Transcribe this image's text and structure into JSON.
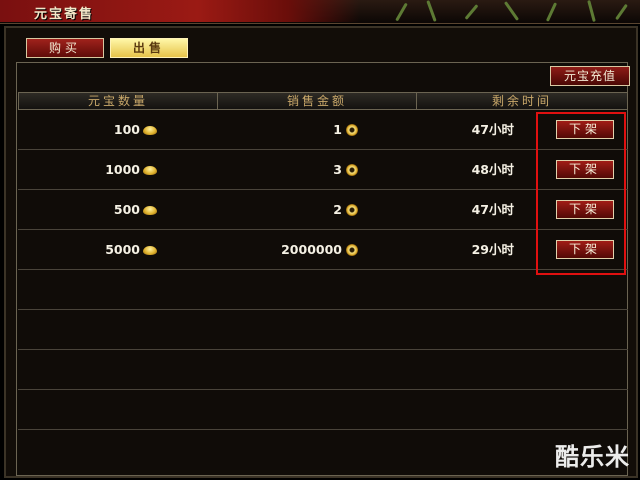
{
  "window": {
    "title": "元宝寄售"
  },
  "tabs": [
    {
      "label": "购买",
      "active": false
    },
    {
      "label": "出售",
      "active": true
    }
  ],
  "recharge_label": "元宝充值",
  "table": {
    "headers": [
      "元宝数量",
      "销售金额",
      "剩余时间"
    ],
    "rows": [
      {
        "quantity": "100",
        "price": "1",
        "time": "47小时",
        "action": "下架"
      },
      {
        "quantity": "1000",
        "price": "3",
        "time": "48小时",
        "action": "下架"
      },
      {
        "quantity": "500",
        "price": "2",
        "time": "47小时",
        "action": "下架"
      },
      {
        "quantity": "5000",
        "price": "2000000",
        "time": "29小时",
        "action": "下架"
      }
    ],
    "empty_rows": 4
  },
  "watermark": "酷乐米",
  "colors": {
    "accent_red": "#a11d17",
    "header_text": "#c9a86a",
    "highlight": "#e01010"
  }
}
